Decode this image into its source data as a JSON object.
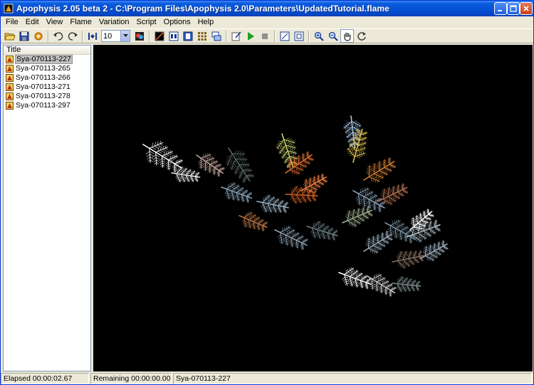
{
  "window": {
    "title": "Apophysis 2.05 beta 2 - C:\\Program Files\\Apophysis 2.0\\Parameters\\UpdatedTutorial.flame"
  },
  "menu": [
    "File",
    "Edit",
    "View",
    "Flame",
    "Variation",
    "Script",
    "Options",
    "Help"
  ],
  "toolbar": {
    "zoom_value": "10"
  },
  "filelist": {
    "header": "Title",
    "items": [
      "Sya-070113-227",
      "Sya-070113-265",
      "Sya-070113-266",
      "Sya-070113-271",
      "Sya-070113-278",
      "Sya-070113-297"
    ],
    "selected_index": 0
  },
  "status": {
    "elapsed": "Elapsed 00:00:02.67",
    "remaining": "Remaining 00:00:00.00",
    "flame": "Sya-070113-227"
  },
  "colors": {
    "canvas_bg": "#000000",
    "titlebar": "#0554d8",
    "chrome": "#ece9d8"
  }
}
